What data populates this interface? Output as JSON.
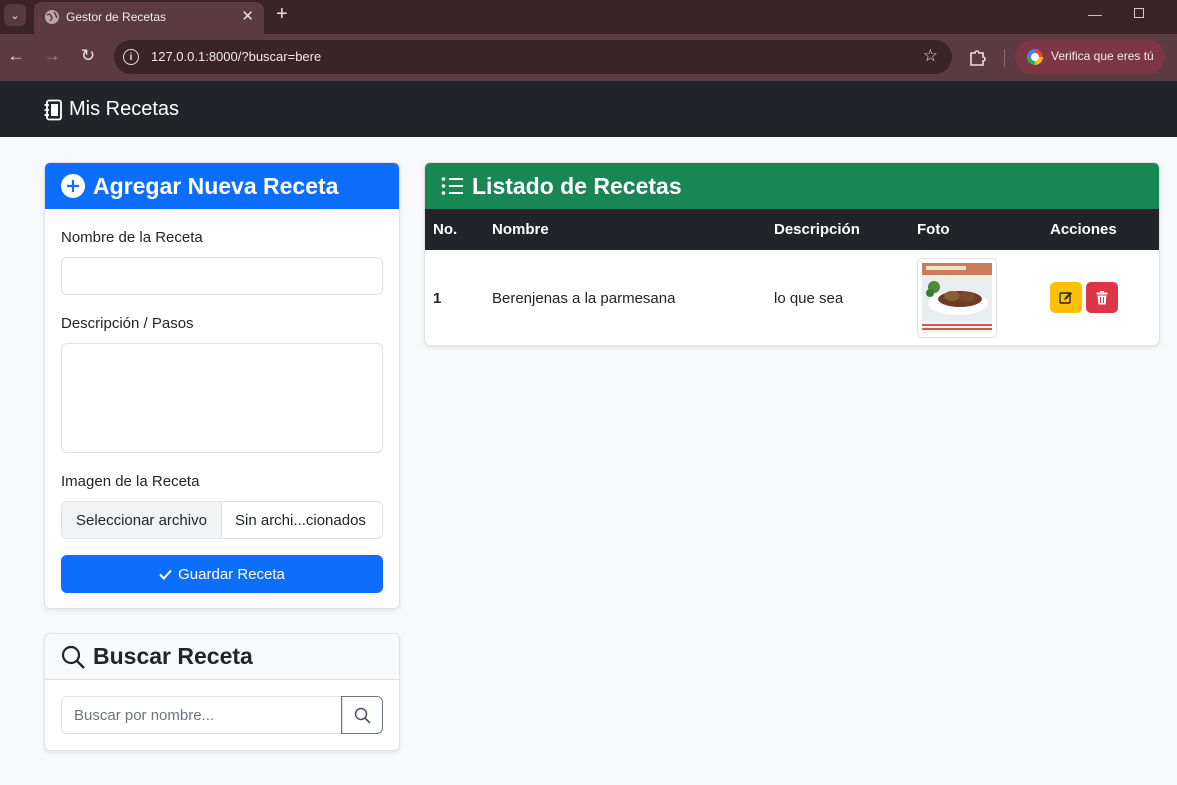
{
  "browser": {
    "tab_title": "Gestor de Recetas",
    "url": "127.0.0.1:8000/?buscar=bere",
    "profile_button": "Verifica que eres tú"
  },
  "navbar": {
    "brand": "Mis Recetas"
  },
  "add_form": {
    "title": "Agregar Nueva Receta",
    "name_label": "Nombre de la Receta",
    "name_value": "",
    "desc_label": "Descripción / Pasos",
    "desc_value": "",
    "image_label": "Imagen de la Receta",
    "file_button": "Seleccionar archivo",
    "file_status": "Sin archi...cionados",
    "save_button": "Guardar Receta"
  },
  "search": {
    "title": "Buscar Receta",
    "placeholder": "Buscar por nombre..."
  },
  "list": {
    "title": "Listado de Recetas",
    "columns": [
      "No.",
      "Nombre",
      "Descripción",
      "Foto",
      "Acciones"
    ],
    "rows": [
      {
        "no": "1",
        "nombre": "Berenjenas a la parmesana",
        "descripcion": "lo que sea"
      }
    ]
  },
  "colors": {
    "primary": "#0d6efd",
    "success": "#198754",
    "warning": "#ffc107",
    "danger": "#dc3545",
    "dark": "#212529"
  },
  "icons": {
    "add_card": "plus-circle-icon",
    "list_card": "list-icon",
    "search_card": "search-icon",
    "brand": "notebook-icon",
    "edit": "edit-icon",
    "delete": "trash-icon"
  }
}
